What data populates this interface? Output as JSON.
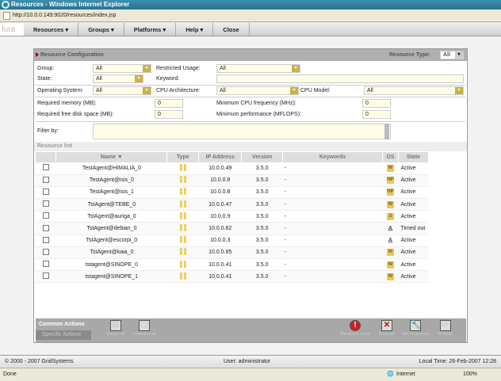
{
  "window": {
    "title": "Resources - Windows Internet Explorer",
    "url": "http://10.0.0.149:9020/resources/index.jsp"
  },
  "menu": {
    "logo": "fura",
    "items": [
      "Resources ▾",
      "Groups ▾",
      "Platforms ▾",
      "Help ▾",
      "Close"
    ]
  },
  "config": {
    "title": "Resource Configuration",
    "resource_type_label": "Resource Type:",
    "resource_type": "All",
    "group_label": "Group:",
    "group": "All",
    "restricted_label": "Restricted Usage:",
    "restricted": "All",
    "state_label": "State:",
    "state": "All",
    "keyword_label": "Keyword:",
    "keyword": "",
    "os_label": "Operating System:",
    "os": "All",
    "arch_label": "CPU Architecture:",
    "arch": "All",
    "model_label": "CPU Model:",
    "model": "All",
    "mem_label": "Required memory (MB):",
    "mem": "0",
    "freq_label": "Minimum CPU frequency (MHz):",
    "freq": "0",
    "disk_label": "Required free disk space (MB):",
    "disk": "0",
    "perf_label": "Minimum performance (MFLOPS):",
    "perf": "0",
    "filter_label": "Filter by:",
    "filter": ""
  },
  "list": {
    "title": "Resource list",
    "columns": [
      "Name ▼",
      "Type",
      "IP Address",
      "Version",
      "Keywords",
      "OS",
      "State"
    ],
    "rows": [
      {
        "name": "TestAgent@HIMALIA_0",
        "ip": "10.0.0.49",
        "version": "3.5.0",
        "keywords": "-",
        "os": "W",
        "state": "Active"
      },
      {
        "name": "TestAgent@isis_0",
        "ip": "10.0.0.8",
        "version": "3.5.0",
        "keywords": "-",
        "os": "HP",
        "state": "Active"
      },
      {
        "name": "TestAgent@isis_1",
        "ip": "10.0.0.8",
        "version": "3.5.0",
        "keywords": "-",
        "os": "HP",
        "state": "Active"
      },
      {
        "name": "TstAgent@TEBE_0",
        "ip": "10.0.0.47",
        "version": "3.5.0",
        "keywords": "-",
        "os": "W",
        "state": "Active"
      },
      {
        "name": "TstAgent@auriga_0",
        "ip": "10.0.0.9",
        "version": "3.5.0",
        "keywords": "-",
        "os": "S",
        "state": "Active"
      },
      {
        "name": "TstAgent@debian_0",
        "ip": "10.0.0.82",
        "version": "3.5.0",
        "keywords": "-",
        "os": "linux",
        "state": "Timed out"
      },
      {
        "name": "TstAgent@escorpi_0",
        "ip": "10.0.0.3",
        "version": "3.5.0",
        "keywords": "-",
        "os": "linux",
        "state": "Active"
      },
      {
        "name": "TstAgent@kaia_0",
        "ip": "10.0.0.85",
        "version": "3.5.0",
        "keywords": "-",
        "os": "M",
        "state": "Active"
      },
      {
        "name": "tstagent@SINOPE_0",
        "ip": "10.0.0.41",
        "version": "3.5.0",
        "keywords": "-",
        "os": "W",
        "state": "Active"
      },
      {
        "name": "tstagent@SINOPE_1",
        "ip": "10.0.0.41",
        "version": "3.5.0",
        "keywords": "-",
        "os": "W",
        "state": "Active"
      }
    ]
  },
  "actions": {
    "common": "Common Actions",
    "specific": "Specific Actions",
    "select_all": "Select all",
    "unselect_all": "Unselect all",
    "reset": "Resource reset",
    "remove": "Remove",
    "set_props": "Set Properties",
    "refresh": "Refresh"
  },
  "footer": {
    "copyright": "© 2000 - 2007 GridSystems",
    "user": "User: administrator",
    "time": "Local Time:  26-Feb-2007 12:28"
  },
  "status": {
    "text": "Done",
    "zone": "Internet",
    "zoom": "100%"
  }
}
